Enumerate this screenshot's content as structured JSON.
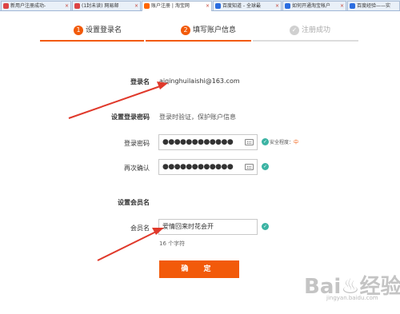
{
  "tabs": [
    {
      "label": "新用户注册成功-",
      "icon_color": "#d44"
    },
    {
      "label": "(1封未读) 网易邮",
      "icon_color": "#d44"
    },
    {
      "label": "账户注册 | 淘宝网",
      "icon_color": "#f60"
    },
    {
      "label": "百度知道 - 全球最",
      "icon_color": "#2b6de0"
    },
    {
      "label": "如何开通淘宝帐户",
      "icon_color": "#2b6de0"
    },
    {
      "label": "百度经验——实",
      "icon_color": "#2b6de0"
    }
  ],
  "steps": [
    {
      "num": "1",
      "label": "设置登录名",
      "state": "done"
    },
    {
      "num": "2",
      "label": "填写账户信息",
      "state": "current"
    },
    {
      "num": "✓",
      "label": "注册成功",
      "state": "pending"
    }
  ],
  "form": {
    "login_label": "登录名",
    "login_value": "aiqinghuilaishi@163.com",
    "pwd_section_title": "设置登录密码",
    "pwd_section_hint": "登录时验证，保护账户信息",
    "pwd_label": "登录密码",
    "pwd_value": "●●●●●●●●●●●●",
    "strength_label": "安全程度：",
    "strength_value": "中",
    "confirm_label": "再次确认",
    "confirm_value": "●●●●●●●●●●●●",
    "member_section_title": "设置会员名",
    "member_label": "会员名",
    "member_value": "爱情回来时花会开",
    "member_hint": "16 个字符",
    "submit_label": "确 定"
  },
  "watermark": {
    "main": "Bai♨经验",
    "sub": "jingyan.baidu.com"
  },
  "colors": {
    "accent": "#f25a0a",
    "done_line": "#f25a0a",
    "pending": "#cccccc",
    "check": "#3bb3a3",
    "arrow": "#e0392b"
  }
}
